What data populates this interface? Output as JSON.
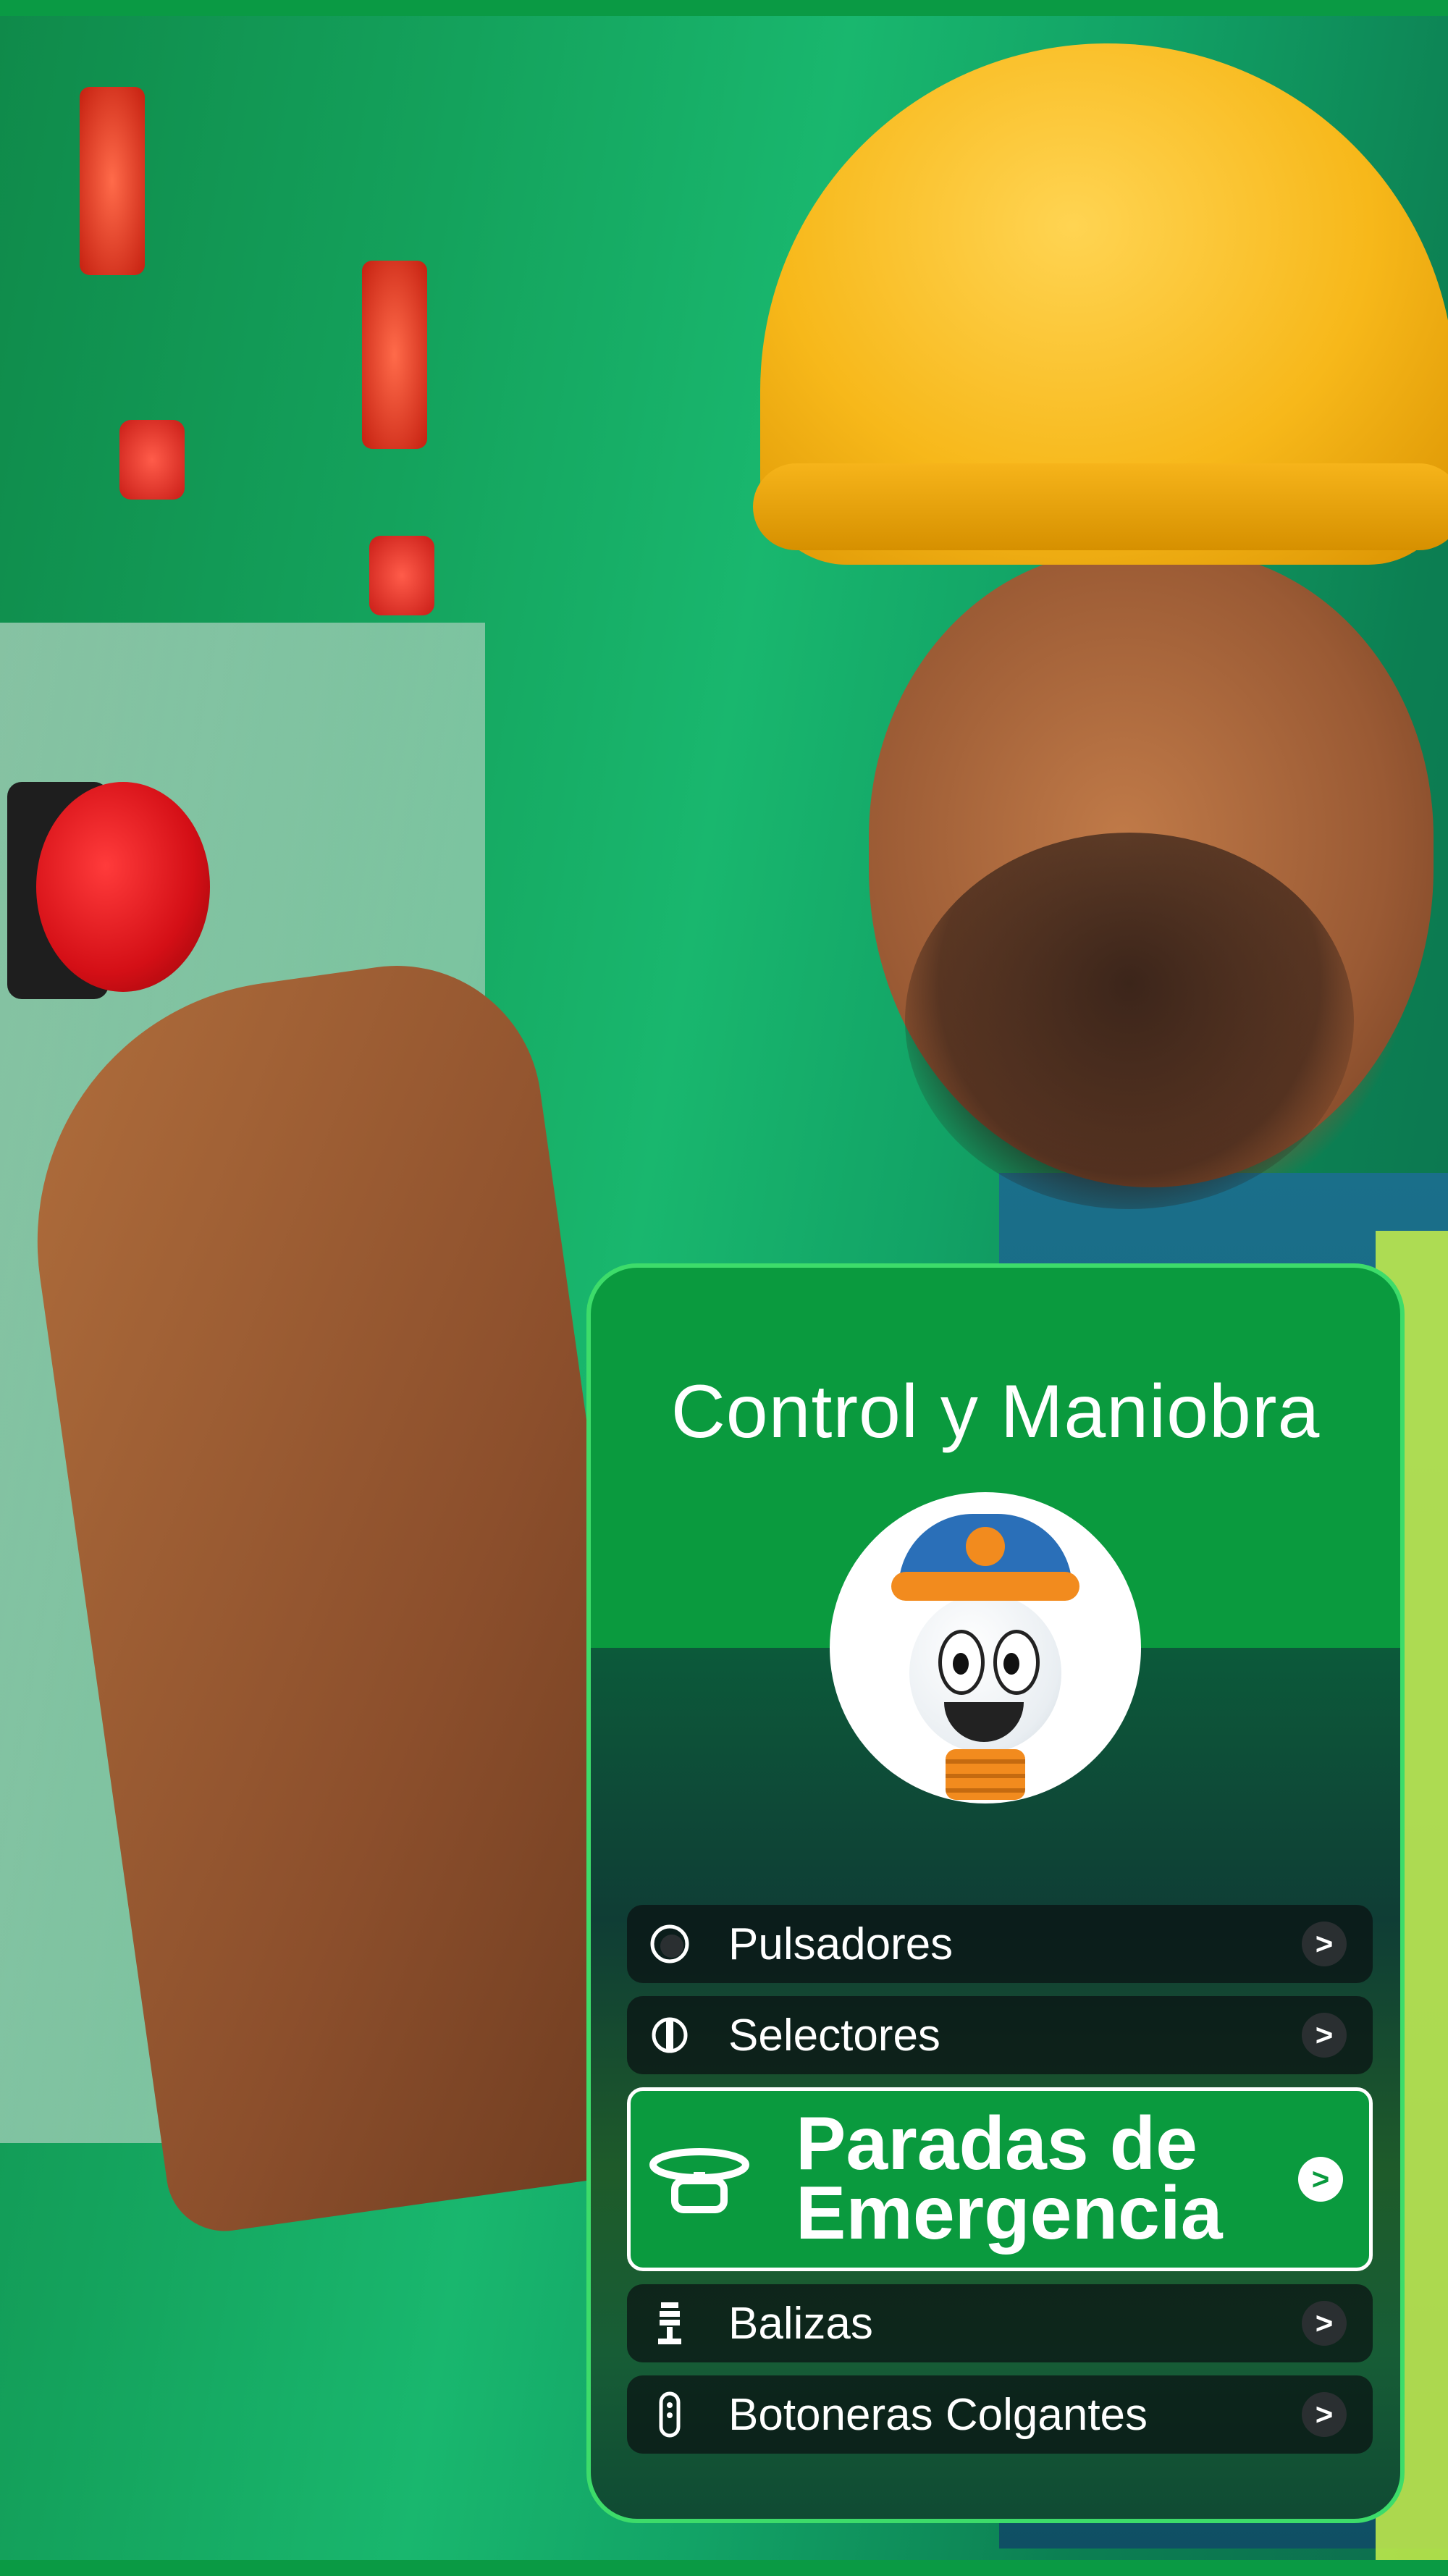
{
  "card": {
    "title": "Control y Maniobra"
  },
  "menu": {
    "items": [
      {
        "label": "Pulsadores",
        "icon": "pushbutton-icon",
        "arrow": ">"
      },
      {
        "label": "Selectores",
        "icon": "selector-icon",
        "arrow": ">"
      },
      {
        "label": "Paradas de Emergencia",
        "label_line1": "Paradas de",
        "label_line2": "Emergencia",
        "icon": "emergency-stop-icon",
        "arrow": ">",
        "active": true
      },
      {
        "label": "Balizas",
        "icon": "beacon-icon",
        "arrow": ">"
      },
      {
        "label": "Botoneras Colgantes",
        "icon": "pendant-station-icon",
        "arrow": ">"
      }
    ]
  },
  "colors": {
    "brand_green": "#0a9a3e",
    "card_border": "#3ddc6a",
    "helmet_yellow": "#f7b81a",
    "estop_red": "#d40f16"
  }
}
